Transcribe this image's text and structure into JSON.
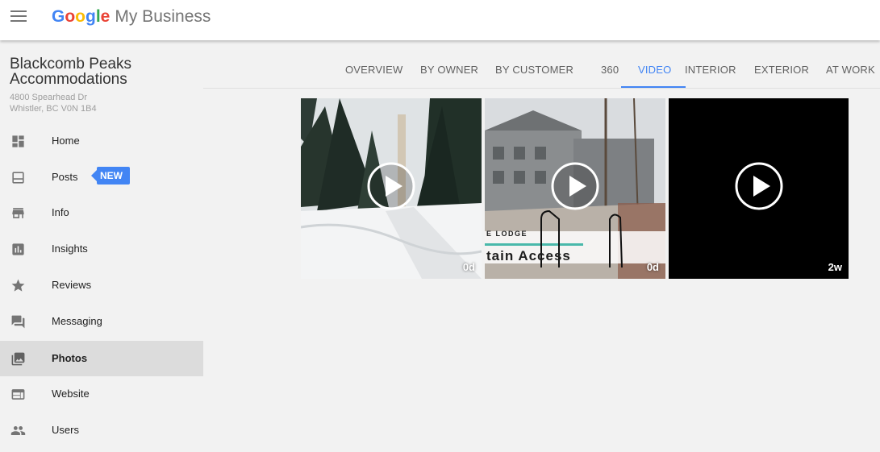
{
  "header": {
    "logo_google": [
      "G",
      "o",
      "o",
      "g",
      "l",
      "e"
    ],
    "logo_colors": [
      "#4285f4",
      "#ea4335",
      "#fbbc05",
      "#4285f4",
      "#34a853",
      "#ea4335"
    ],
    "product_name": "My Business",
    "menu_icon": "hamburger-menu-icon"
  },
  "business": {
    "name": "Blackcomb Peaks Accommodations",
    "address_line1": "4800 Spearhead Dr",
    "address_line2": "Whistler, BC V0N 1B4"
  },
  "sidebar": {
    "items": [
      {
        "label": "Home",
        "icon": "dashboard-icon"
      },
      {
        "label": "Posts",
        "icon": "posts-icon",
        "badge": "NEW"
      },
      {
        "label": "Info",
        "icon": "storefront-icon"
      },
      {
        "label": "Insights",
        "icon": "bar-chart-icon"
      },
      {
        "label": "Reviews",
        "icon": "star-icon"
      },
      {
        "label": "Messaging",
        "icon": "chat-icon"
      },
      {
        "label": "Photos",
        "icon": "photo-icon",
        "active": true
      },
      {
        "label": "Website",
        "icon": "web-icon"
      },
      {
        "label": "Users",
        "icon": "users-icon"
      }
    ]
  },
  "tabs": [
    {
      "label": "OVERVIEW"
    },
    {
      "label": "BY OWNER"
    },
    {
      "label": "BY CUSTOMER"
    },
    {
      "label": "360"
    },
    {
      "label": "VIDEO",
      "active": true
    },
    {
      "label": "INTERIOR"
    },
    {
      "label": "EXTERIOR"
    },
    {
      "label": "AT WORK"
    }
  ],
  "videos": [
    {
      "age": "0d",
      "icon": "play-icon",
      "overlay_text": ""
    },
    {
      "age": "0d",
      "icon": "play-icon",
      "overlay_text_1": "E LODGE",
      "overlay_text_2": "tain Access"
    },
    {
      "age": "2w",
      "icon": "play-icon",
      "overlay_text": ""
    }
  ],
  "colors": {
    "accent": "#4285f4",
    "active_nav_bg": "#dcdcdc",
    "text_muted": "#9e9e9e"
  }
}
